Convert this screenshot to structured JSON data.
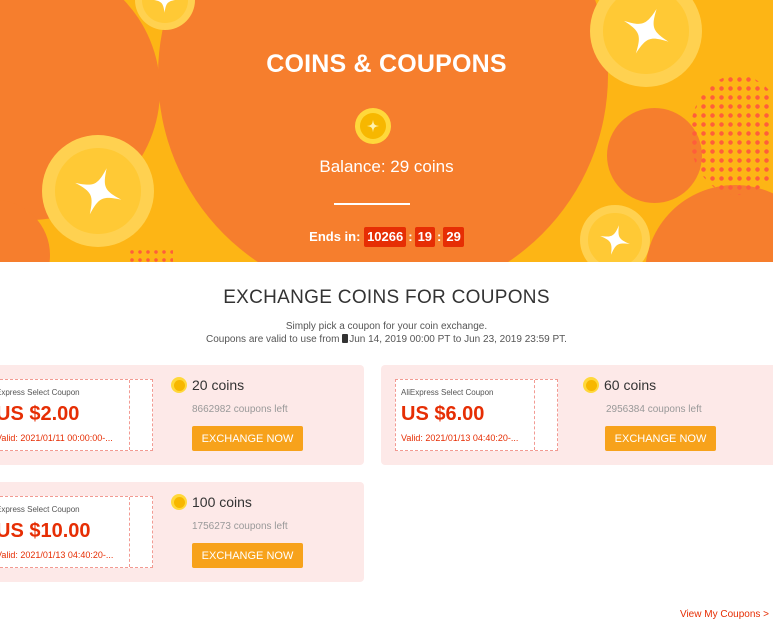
{
  "hero": {
    "title": "COINS & COUPONS",
    "balance": "Balance: 29 coins",
    "countdown_label": "Ends in:",
    "countdown": [
      "10266",
      "19",
      "29"
    ],
    "countdown_sep": ":",
    "colors": {
      "background": "#fdb515",
      "accent": "#f67e2d",
      "timer": "#e62e04"
    }
  },
  "section": {
    "title": "EXCHANGE COINS FOR COUPONS",
    "subtitle_line1": "Simply pick a coupon for your coin exchange.",
    "subtitle_line2_a": "Coupons are valid to use from ",
    "subtitle_line2_b": "Jun 14, 2019 00:00 PT to Jun 23, 2019 23:59 PT."
  },
  "coupons": [
    {
      "name": "Express Select Coupon",
      "price": "US $2.00",
      "valid": "Valid: 2021/01/11 00:00:00-...",
      "coins": "20 coins",
      "left": "8662982 coupons left",
      "button": "EXCHANGE NOW"
    },
    {
      "name": "AliExpress Select Coupon",
      "price": "US $6.00",
      "valid": "Valid: 2021/01/13 04:40:20-...",
      "coins": "60 coins",
      "left": "2956384 coupons left",
      "button": "EXCHANGE NOW"
    },
    {
      "name": "Express Select Coupon",
      "price": "US $10.00",
      "valid": "Valid: 2021/01/13 04:40:20-...",
      "coins": "100 coins",
      "left": "1756273 coupons left",
      "button": "EXCHANGE NOW"
    }
  ],
  "footer": {
    "link": "View My Coupons >"
  },
  "icons": {
    "coin": "coin-icon",
    "star": "star-icon",
    "phone": "phone-icon"
  }
}
